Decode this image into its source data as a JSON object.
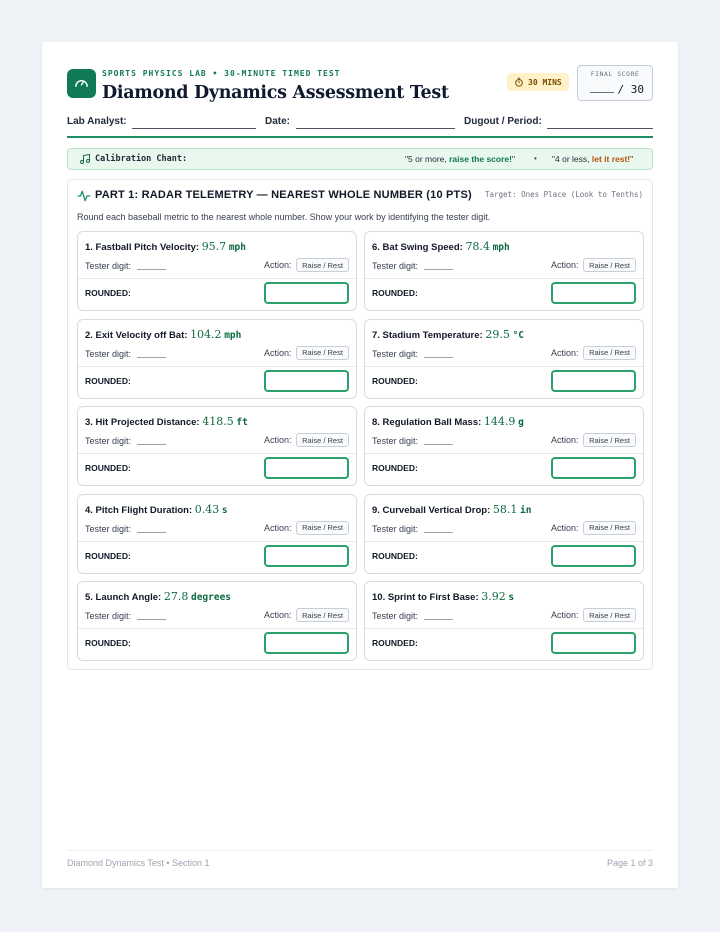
{
  "header": {
    "eyebrow": "SPORTS PHYSICS LAB • 30-MINUTE TIMED TEST",
    "title": "Diamond Dynamics Assessment Test",
    "timer": "30 MINS",
    "score_label": "FINAL SCORE",
    "score_total": "/ 30"
  },
  "fields": {
    "analyst": "Lab Analyst:",
    "date": "Date:",
    "dugout": "Dugout / Period:"
  },
  "chant": {
    "label": "Calibration Chant:",
    "rule1_pre": "\"5 or more, ",
    "rule1_em": "raise the score!",
    "rule1_post": "\"",
    "bullet": "•",
    "rule2_pre": "\"4 or less, ",
    "rule2_em": "let it rest!",
    "rule2_post": "\""
  },
  "part": {
    "heading": "PART 1: RADAR TELEMETRY — NEAREST WHOLE NUMBER (10 PTS)",
    "target": "Target: Ones Place (Look to Tenths)",
    "instruction": "Round each baseball metric to the nearest whole number. Show your work by identifying the tester digit."
  },
  "card_labels": {
    "tester": "Tester digit:",
    "action": "Action:",
    "button": "Raise / Rest",
    "rounded": "ROUNDED:"
  },
  "problems": [
    {
      "label": "1. Fastball Pitch Velocity:",
      "value": "95.7",
      "unit": "mph"
    },
    {
      "label": "6. Bat Swing Speed:",
      "value": "78.4",
      "unit": "mph"
    },
    {
      "label": "2. Exit Velocity off Bat:",
      "value": "104.2",
      "unit": "mph"
    },
    {
      "label": "7. Stadium Temperature:",
      "value": "29.5",
      "unit": "°C"
    },
    {
      "label": "3. Hit Projected Distance:",
      "value": "418.5",
      "unit": "ft"
    },
    {
      "label": "8. Regulation Ball Mass:",
      "value": "144.9",
      "unit": "g"
    },
    {
      "label": "4. Pitch Flight Duration:",
      "value": "0.43",
      "unit": "s"
    },
    {
      "label": "9. Curveball Vertical Drop:",
      "value": "58.1",
      "unit": "in"
    },
    {
      "label": "5. Launch Angle:",
      "value": "27.8",
      "unit": "degrees"
    },
    {
      "label": "10. Sprint to First Base:",
      "value": "3.92",
      "unit": "s"
    }
  ],
  "footer": {
    "left": "Diamond Dynamics Test • Section 1",
    "right": "Page 1 of 3"
  }
}
